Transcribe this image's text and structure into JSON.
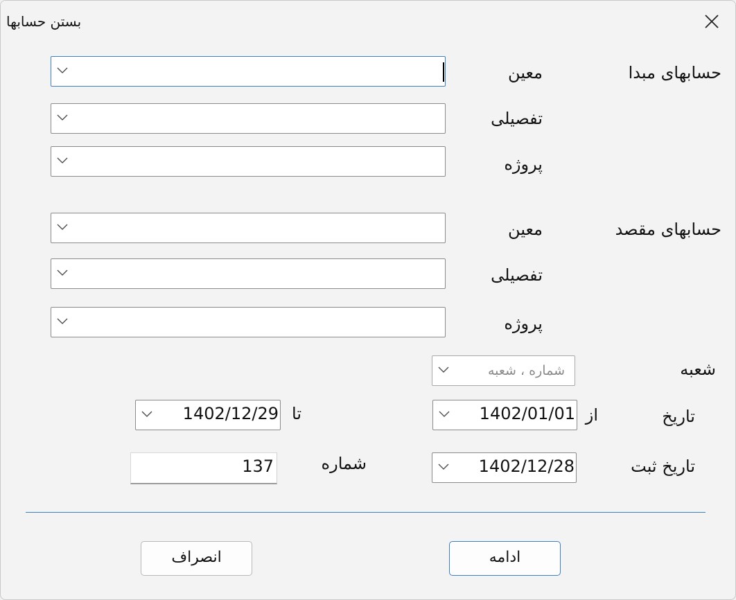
{
  "window": {
    "title": "بستن حسابها"
  },
  "source": {
    "section_label": "حسابهای مبدا",
    "moein_label": "معین",
    "tafsili_label": "تفصیلی",
    "project_label": "پروژه",
    "moein_value": "",
    "tafsili_value": "",
    "project_value": ""
  },
  "target": {
    "section_label": "حسابهای مقصد",
    "moein_label": "معین",
    "tafsili_label": "تفصیلی",
    "project_label": "پروژه",
    "moein_value": "",
    "tafsili_value": "",
    "project_value": ""
  },
  "branch": {
    "label": "شعبه",
    "placeholder": "شماره ، شعبه"
  },
  "date_range": {
    "label": "تاریخ",
    "from_label": "از",
    "from_value": "1402/01/01",
    "to_label": "تا",
    "to_value": "1402/12/29"
  },
  "registration": {
    "date_label": "تاریخ ثبت",
    "date_value": "1402/12/28",
    "number_label": "شماره",
    "number_value": "137"
  },
  "buttons": {
    "continue": "ادامه",
    "cancel": "انصراف"
  },
  "colors": {
    "accent": "#3d7fc1",
    "window_bg": "#f3f3f3"
  }
}
